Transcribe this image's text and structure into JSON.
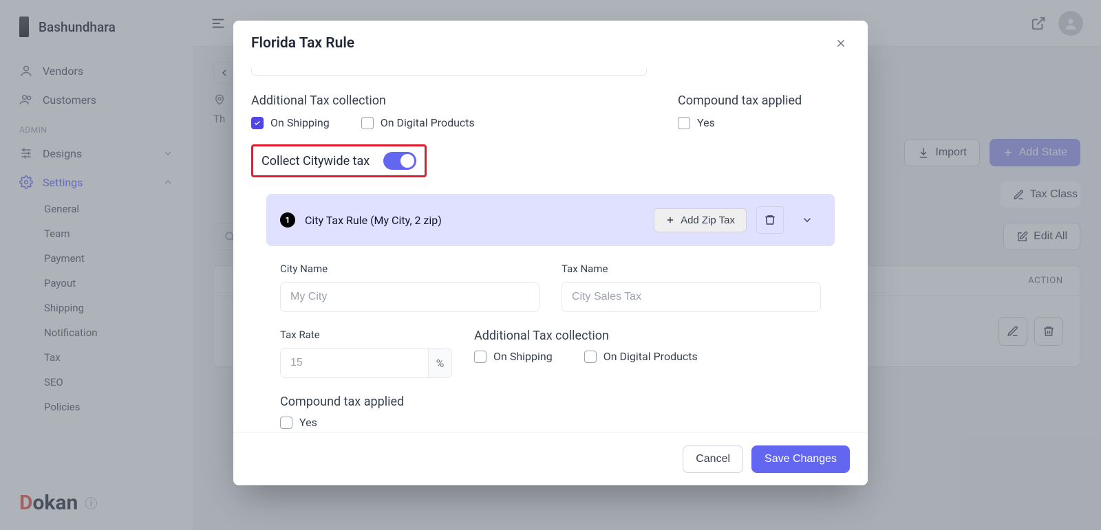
{
  "brand": {
    "name": "Bashundhara"
  },
  "nav": {
    "items": [
      "Vendors",
      "Customers"
    ],
    "admin_label": "ADMIN",
    "designs": "Designs",
    "settings": "Settings",
    "settings_children": [
      "General",
      "Team",
      "Payment",
      "Payout",
      "Shipping",
      "Notification",
      "Tax",
      "SEO",
      "Policies"
    ]
  },
  "footer_logo": {
    "d": "D",
    "rest": "okan"
  },
  "content": {
    "crumb_prefix": "Th",
    "import": "Import",
    "add_state": "Add State",
    "tax_class": "Tax Class",
    "edit_all": "Edit All",
    "action_col": "ACTION"
  },
  "modal": {
    "title": "Florida Tax Rule",
    "additional_label": "Additional Tax collection",
    "compound_label": "Compound tax applied",
    "on_shipping": "On Shipping",
    "on_digital": "On Digital Products",
    "yes": "Yes",
    "citywide": "Collect Citywide tax",
    "city_rule_title": "City Tax Rule (My City, 2 zip)",
    "badge": "1",
    "add_zip": "Add Zip Tax",
    "fields": {
      "city_name_label": "City Name",
      "city_name_value": "My City",
      "tax_name_label": "Tax Name",
      "tax_name_value": "City Sales Tax",
      "tax_rate_label": "Tax Rate",
      "tax_rate_value": "15",
      "percent": "%",
      "additional_label2": "Additional Tax collection",
      "compound_label2": "Compound tax applied"
    },
    "cancel": "Cancel",
    "save": "Save Changes"
  }
}
